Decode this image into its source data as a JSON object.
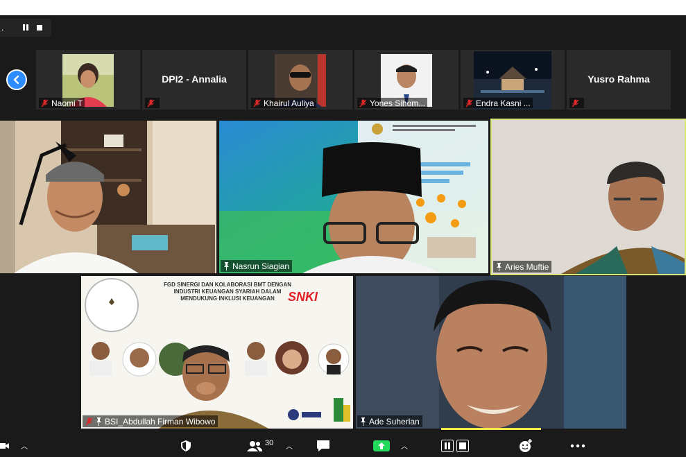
{
  "top_bar": {
    "status_text": "."
  },
  "participants_strip": [
    {
      "name": "Naomi T",
      "has_video": true
    },
    {
      "name": "",
      "big_name": "DPI2 - Annalia",
      "has_video": false
    },
    {
      "name": "Khairul Auliya",
      "has_video": true
    },
    {
      "name": "Yones Sihom...",
      "has_video": true
    },
    {
      "name": "Endra Kasni ...",
      "has_video": true
    },
    {
      "name": "",
      "big_name": "Yusro Rahma",
      "has_video": false
    }
  ],
  "video_tiles": [
    {
      "name": "",
      "pinned": false
    },
    {
      "name": "Nasrun Siagian",
      "pinned": true
    },
    {
      "name": "Aries Muftie",
      "pinned": true,
      "active_speaker": true
    },
    {
      "name": "BSI_Abdullah Firman Wibowo",
      "pinned": true,
      "mic_muted": true
    },
    {
      "name": "Ade Suherlan",
      "pinned": true
    }
  ],
  "shared_slide": {
    "title_lines": [
      "FGD SINERGI DAN KOLABORASI BMT DENGAN",
      "INDUSTRI KEUANGAN SYARIAH DALAM",
      "MENDUKUNG INKLUSI KEUANGAN"
    ],
    "brand": "SNKI"
  },
  "toolbar": {
    "participants_count": "30",
    "icons": [
      "video-icon",
      "security-icon",
      "participants-icon",
      "chat-icon",
      "share-screen-icon",
      "record-icon",
      "reactions-icon",
      "more-icon"
    ]
  },
  "colors": {
    "accent": "#2d8cff",
    "share_green": "#23d959",
    "active_speaker": "#d9e67a",
    "mic_muted": "#e02828"
  }
}
